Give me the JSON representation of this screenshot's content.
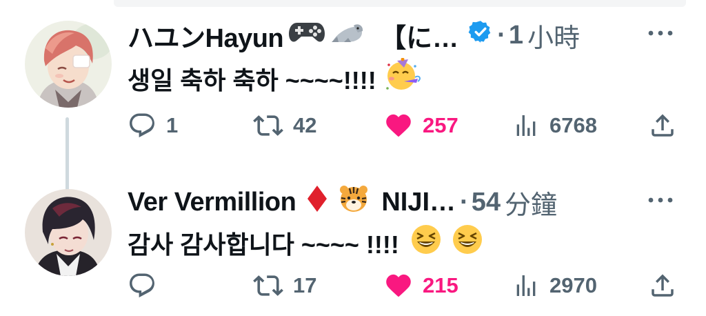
{
  "tweets": [
    {
      "display_name": "ハユンHayun",
      "emojis_after_name": [
        "game-controller-emoji",
        "seal-emoji"
      ],
      "handle_prefix": "【に…",
      "verified": true,
      "separator": "·",
      "time_value": "1",
      "time_unit": "小時",
      "text": "생일 축하 축하 ~~~~!!!!",
      "text_emoji": "partying-face-emoji",
      "replies": "1",
      "retweets": "42",
      "likes": "257",
      "views": "6768",
      "liked": true
    },
    {
      "display_name": "Ver Vermillion",
      "emojis_after_name": [
        "diamond-suit-emoji",
        "tiger-face-emoji"
      ],
      "handle_prefix": "NIJI…",
      "verified": false,
      "separator": "·",
      "time_value": "54",
      "time_unit": "分鐘",
      "text": "감사 감사합니다 ~~~~ !!!!",
      "text_emoji": "grinning-squinting-face-emoji",
      "replies": "",
      "retweets": "17",
      "likes": "215",
      "views": "2970",
      "liked": true
    }
  ],
  "colors": {
    "like": "#f91880",
    "secondary_text": "#536471",
    "verified": "#1d9bf0",
    "thread_line": "#cfd9de"
  }
}
